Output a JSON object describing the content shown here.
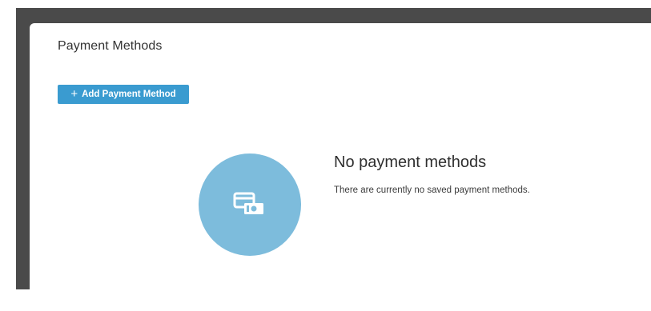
{
  "page": {
    "title": "Payment Methods"
  },
  "actions": {
    "add_payment_method_label": "Add Payment Method",
    "add_icon": "plus-icon"
  },
  "empty_state": {
    "icon": "credit-card-cash-icon",
    "title": "No payment methods",
    "message": "There are currently no saved payment methods."
  },
  "colors": {
    "frame": "#4a4a4a",
    "accent": "#3a9bd0",
    "empty_circle": "#7dbcdc"
  }
}
